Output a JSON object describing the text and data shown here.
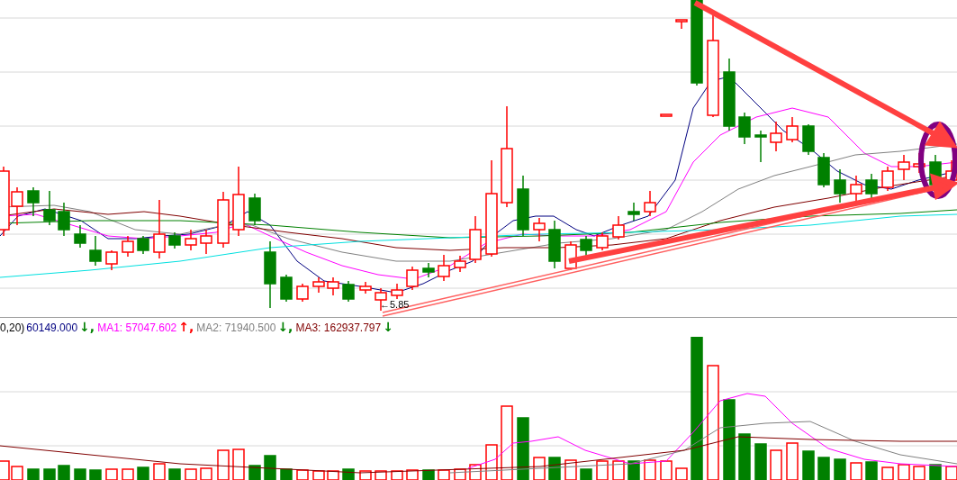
{
  "price_panel": {
    "low_label": {
      "arrow": "←",
      "value": "5.85"
    }
  },
  "volume_legend": [
    {
      "kind": "value",
      "text": "0,20)",
      "color": "#000000"
    },
    {
      "kind": "value",
      "text": "60149.000",
      "color": "#000080"
    },
    {
      "kind": "arrow",
      "text": "↓,",
      "color": "#008000"
    },
    {
      "kind": "value",
      "text": "MA1: 57047.602",
      "color": "#ff00ff"
    },
    {
      "kind": "arrow",
      "text": "↑,",
      "color": "#ff0000"
    },
    {
      "kind": "value",
      "text": "MA2: 71940.500",
      "color": "#808080"
    },
    {
      "kind": "arrow",
      "text": "↓,",
      "color": "#008000"
    },
    {
      "kind": "value",
      "text": "MA3: 162937.797",
      "color": "#800000"
    },
    {
      "kind": "arrow",
      "text": "↓",
      "color": "#008000"
    }
  ]
}
